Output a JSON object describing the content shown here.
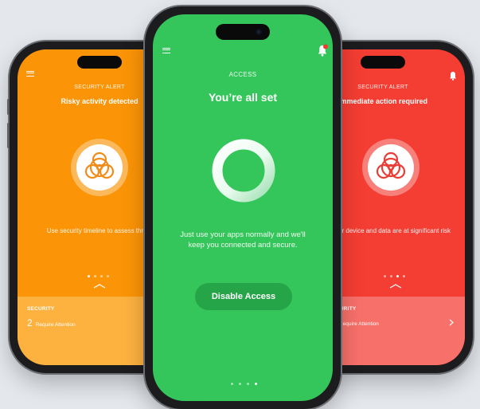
{
  "left_screen": {
    "alert_label": "SECURITY ALERT",
    "title": "Risky activity detected",
    "description": "Use security timeline to assess threat",
    "panel": {
      "title": "SECURITY",
      "count": "2",
      "status": "Require Attention"
    },
    "background": "#fb9406",
    "panel_color": "#fdb13f"
  },
  "center_screen": {
    "label": "ACCESS",
    "title": "You’re all set",
    "description": "Just use your apps normally and we'll keep you connected and secure.",
    "button_label": "Disable Access",
    "background": "#34c65a",
    "button_color": "#25a548"
  },
  "right_screen": {
    "alert_label": "SECURITY ALERT",
    "title": "Immediate action required",
    "description": "Your device and data are at significant risk",
    "panel": {
      "title": "CURITY",
      "status": "Require Attention"
    },
    "background": "#f43d33",
    "panel_color": "#f8706a"
  }
}
